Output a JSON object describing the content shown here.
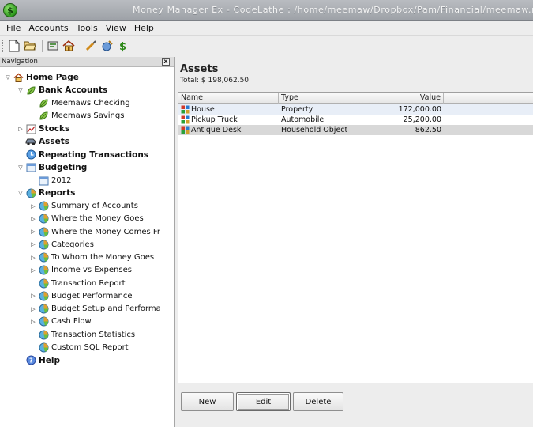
{
  "window": {
    "title": "Money Manager Ex - CodeLathe : /home/meemaw/Dropbox/Pam/Financial/meemaw.mmb",
    "app_icon_glyph": "$"
  },
  "menu": [
    {
      "label": "File",
      "mnemonic": "F",
      "rest": "ile"
    },
    {
      "label": "Accounts",
      "mnemonic": "A",
      "rest": "ccounts"
    },
    {
      "label": "Tools",
      "mnemonic": "T",
      "rest": "ools"
    },
    {
      "label": "View",
      "mnemonic": "V",
      "rest": "iew"
    },
    {
      "label": "Help",
      "mnemonic": "H",
      "rest": "elp"
    }
  ],
  "toolbar": [
    "new-file-icon",
    "open-folder-icon",
    "new-account-icon",
    "home-icon",
    "options-icon",
    "help-icon",
    "dollar-icon"
  ],
  "navigation": {
    "header": "Navigation",
    "close_glyph": "x",
    "items": [
      {
        "label": "Home Page",
        "level": 0,
        "expander": "open",
        "icon": "home-icon",
        "bold": true
      },
      {
        "label": "Bank Accounts",
        "level": 1,
        "expander": "open",
        "icon": "bank-leaf-icon",
        "bold": true
      },
      {
        "label": "Meemaws Checking",
        "level": 2,
        "expander": "none",
        "icon": "bank-leaf-icon",
        "bold": false
      },
      {
        "label": "Meemaws Savings",
        "level": 2,
        "expander": "none",
        "icon": "bank-leaf-icon",
        "bold": false
      },
      {
        "label": "Stocks",
        "level": 1,
        "expander": "closed",
        "icon": "stocks-chart-icon",
        "bold": true
      },
      {
        "label": "Assets",
        "level": 1,
        "expander": "none",
        "icon": "car-icon",
        "bold": true
      },
      {
        "label": "Repeating Transactions",
        "level": 1,
        "expander": "none",
        "icon": "clock-icon",
        "bold": true
      },
      {
        "label": "Budgeting",
        "level": 1,
        "expander": "open",
        "icon": "calendar-icon",
        "bold": true
      },
      {
        "label": "2012",
        "level": 2,
        "expander": "none",
        "icon": "calendar-icon",
        "bold": false
      },
      {
        "label": "Reports",
        "level": 1,
        "expander": "open",
        "icon": "pie-chart-icon",
        "bold": true
      },
      {
        "label": "Summary of Accounts",
        "level": 2,
        "expander": "closed",
        "icon": "pie-chart-icon",
        "bold": false
      },
      {
        "label": "Where the Money Goes",
        "level": 2,
        "expander": "closed",
        "icon": "pie-chart-icon",
        "bold": false
      },
      {
        "label": "Where the Money Comes Fr",
        "level": 2,
        "expander": "closed",
        "icon": "pie-chart-icon",
        "bold": false
      },
      {
        "label": "Categories",
        "level": 2,
        "expander": "closed",
        "icon": "pie-chart-icon",
        "bold": false
      },
      {
        "label": "To Whom the Money Goes",
        "level": 2,
        "expander": "closed",
        "icon": "pie-chart-icon",
        "bold": false
      },
      {
        "label": "Income vs Expenses",
        "level": 2,
        "expander": "closed",
        "icon": "pie-chart-icon",
        "bold": false
      },
      {
        "label": "Transaction Report",
        "level": 2,
        "expander": "none",
        "icon": "pie-chart-icon",
        "bold": false
      },
      {
        "label": "Budget Performance",
        "level": 2,
        "expander": "closed",
        "icon": "pie-chart-icon",
        "bold": false
      },
      {
        "label": "Budget Setup and Performa",
        "level": 2,
        "expander": "closed",
        "icon": "pie-chart-icon",
        "bold": false
      },
      {
        "label": "Cash Flow",
        "level": 2,
        "expander": "closed",
        "icon": "pie-chart-icon",
        "bold": false
      },
      {
        "label": "Transaction Statistics",
        "level": 2,
        "expander": "none",
        "icon": "pie-chart-icon",
        "bold": false
      },
      {
        "label": "Custom SQL Report",
        "level": 2,
        "expander": "none",
        "icon": "pie-chart-icon",
        "bold": false
      },
      {
        "label": "Help",
        "level": 1,
        "expander": "none",
        "icon": "help-globe-icon",
        "bold": true
      }
    ]
  },
  "assets": {
    "title": "Assets",
    "total_label": "Total: $ 198,062.50",
    "columns": [
      "Name",
      "Type",
      "Value",
      ""
    ],
    "rows": [
      {
        "name": "House",
        "type": "Property",
        "value": "172,000.00"
      },
      {
        "name": "Pickup Truck",
        "type": "Automobile",
        "value": "25,200.00"
      },
      {
        "name": "Antique Desk",
        "type": "Household Object",
        "value": "862.50"
      }
    ],
    "buttons": {
      "new": "New",
      "edit": "Edit",
      "delete": "Delete"
    }
  }
}
